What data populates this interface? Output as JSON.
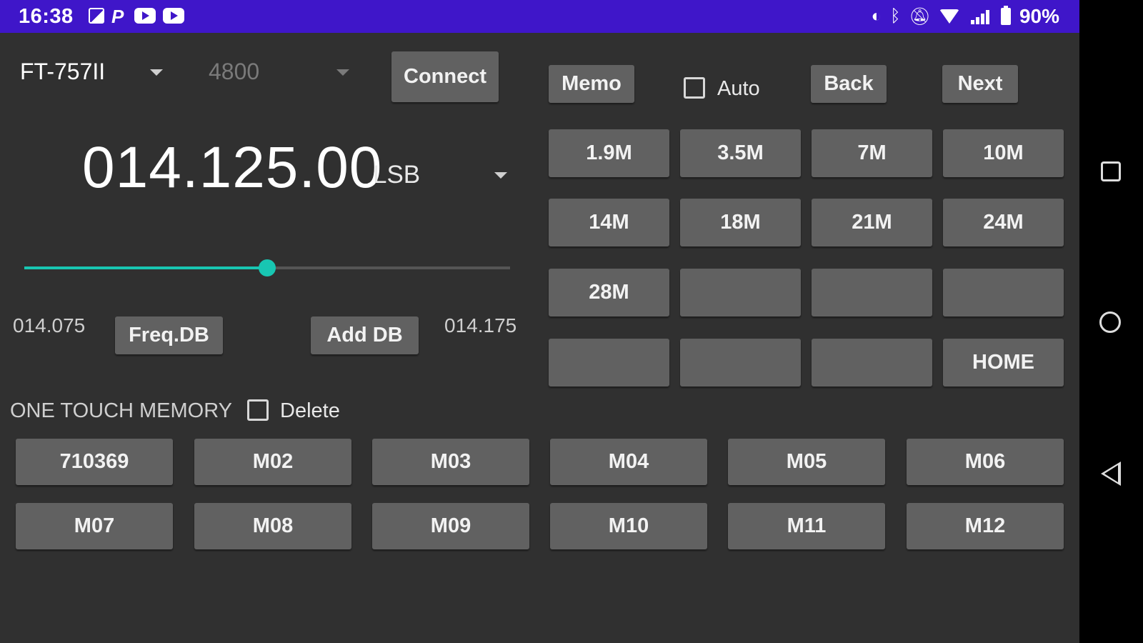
{
  "status_bar": {
    "time": "16:38",
    "battery": "90%",
    "color": "#3f16c9",
    "icons": [
      "gallery-icon",
      "p-app-icon",
      "youtube-icon",
      "youtube-icon",
      "data-saver-icon",
      "bluetooth-icon",
      "mute-icon",
      "wifi-icon",
      "signal-icon",
      "battery-icon"
    ]
  },
  "toolbar": {
    "radio_model": "FT-757II",
    "baud_rate": "4800",
    "connect_label": "Connect",
    "memo_label": "Memo",
    "auto_label": "Auto",
    "back_label": "Back",
    "next_label": "Next"
  },
  "display": {
    "frequency": "014.125.00",
    "mode": "LSB"
  },
  "slider": {
    "value_fraction": 0.5,
    "min_label": "014.075",
    "max_label": "014.175",
    "accent": "#18c6b2"
  },
  "db_buttons": {
    "freq_db": "Freq.DB",
    "add_db": "Add DB"
  },
  "band_buttons": [
    "1.9M",
    "3.5M",
    "7M",
    "10M",
    "14M",
    "18M",
    "21M",
    "24M",
    "28M",
    "",
    "",
    "",
    "",
    "",
    "",
    "HOME"
  ],
  "memory": {
    "heading": "ONE TOUCH MEMORY",
    "delete_label": "Delete",
    "buttons": [
      "710369",
      "M02",
      "M03",
      "M04",
      "M05",
      "M06",
      "M07",
      "M08",
      "M09",
      "M10",
      "M11",
      "M12"
    ]
  }
}
